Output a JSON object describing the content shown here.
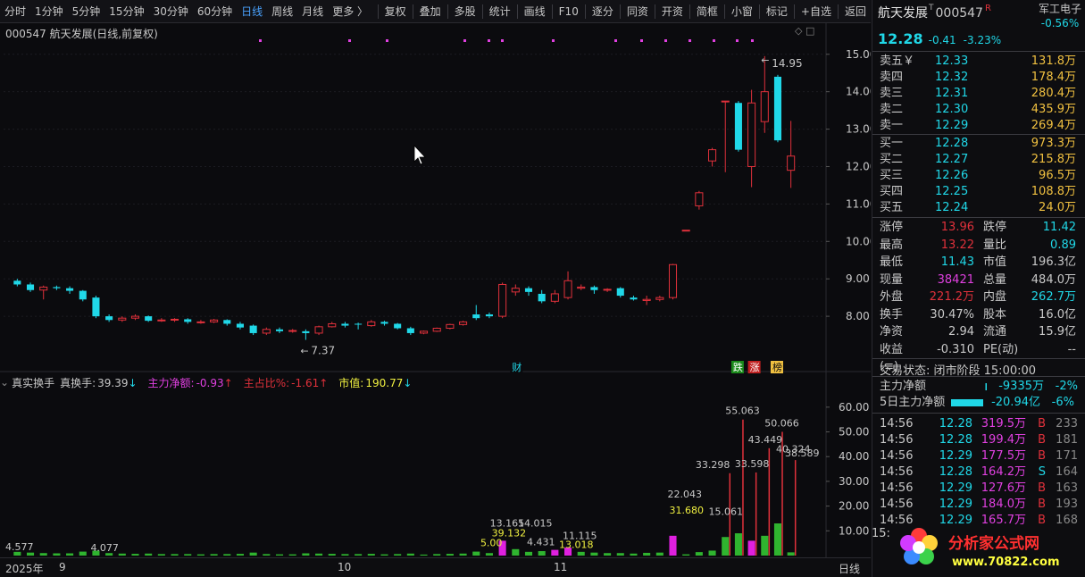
{
  "toolbar": {
    "items": [
      "分时",
      "1分钟",
      "5分钟",
      "15分钟",
      "30分钟",
      "60分钟",
      "日线",
      "周线",
      "月线",
      "更多 〉"
    ],
    "active": "日线",
    "tools": [
      "复权",
      "叠加",
      "多股",
      "统计",
      "画线",
      "F10",
      "逐分",
      "同资",
      "开资",
      "简框",
      "小窗",
      "标记",
      "+自选",
      "返回"
    ]
  },
  "chart": {
    "title": "000547 航天发展(日线,前复权)",
    "price_axis": [
      "15.00",
      "14.00",
      "13.00",
      "12.00",
      "11.00",
      "10.00",
      "9.00",
      "8.00"
    ],
    "high_label": "14.95",
    "low_label": "7.37",
    "markers": [
      "财",
      "跌",
      "涨",
      "榜"
    ],
    "indicator": {
      "name": "真实换手",
      "zhs_label": "真换手:",
      "zhs_value": "39.39",
      "zljq_label": "主力净额:",
      "zljq_value": "-0.93",
      "zzb_label": "主占比%:",
      "zzb_value": "-1.61",
      "sz_label": "市值:",
      "sz_value": "190.77"
    },
    "volume_axis": [
      "60.00",
      "50.00",
      "40.00",
      "30.00",
      "20.00",
      "10.00"
    ],
    "volume_labels": [
      "55.063",
      "50.066",
      "43.449",
      "40.324",
      "38.589",
      "33.298",
      "33.598",
      "22.043",
      "31.680",
      "15.061",
      "39.132",
      "13.165",
      "14.015",
      "11.115",
      "13.018",
      "5.00",
      "4.431",
      "4.577",
      "4.077"
    ],
    "dates": [
      "2025年",
      "9",
      "10",
      "11"
    ],
    "period": "日线"
  },
  "chart_data": {
    "type": "candlestick",
    "ylim": [
      7.0,
      15.4
    ],
    "candles": [
      [
        8.95,
        8.85,
        9.0,
        8.8
      ],
      [
        8.85,
        8.7,
        8.9,
        8.65
      ],
      [
        8.7,
        8.78,
        8.82,
        8.45
      ],
      [
        8.78,
        8.75,
        8.82,
        8.7
      ],
      [
        8.75,
        8.68,
        8.8,
        8.6
      ],
      [
        8.68,
        8.45,
        8.7,
        8.4
      ],
      [
        8.5,
        8.0,
        8.55,
        7.95
      ],
      [
        8.0,
        7.9,
        8.05,
        7.85
      ],
      [
        7.9,
        7.95,
        8.0,
        7.85
      ],
      [
        7.95,
        8.0,
        8.05,
        7.9
      ],
      [
        8.0,
        7.88,
        8.02,
        7.85
      ],
      [
        7.88,
        7.9,
        7.95,
        7.85
      ],
      [
        7.9,
        7.92,
        7.95,
        7.85
      ],
      [
        7.92,
        7.85,
        7.95,
        7.8
      ],
      [
        7.85,
        7.85,
        7.9,
        7.8
      ],
      [
        7.85,
        7.9,
        7.93,
        7.82
      ],
      [
        7.9,
        7.8,
        7.92,
        7.75
      ],
      [
        7.8,
        7.7,
        7.85,
        7.65
      ],
      [
        7.75,
        7.55,
        7.78,
        7.5
      ],
      [
        7.55,
        7.65,
        7.7,
        7.5
      ],
      [
        7.65,
        7.6,
        7.7,
        7.55
      ],
      [
        7.6,
        7.62,
        7.66,
        7.56
      ],
      [
        7.6,
        7.55,
        7.65,
        7.37
      ],
      [
        7.55,
        7.72,
        7.75,
        7.5
      ],
      [
        7.72,
        7.8,
        7.85,
        7.7
      ],
      [
        7.8,
        7.75,
        7.85,
        7.7
      ],
      [
        7.8,
        7.78,
        7.83,
        7.65
      ],
      [
        7.75,
        7.85,
        7.9,
        7.72
      ],
      [
        7.85,
        7.8,
        7.88,
        7.75
      ],
      [
        7.8,
        7.68,
        7.82,
        7.65
      ],
      [
        7.68,
        7.55,
        7.72,
        7.5
      ],
      [
        7.55,
        7.6,
        7.62,
        7.52
      ],
      [
        7.6,
        7.68,
        7.7,
        7.58
      ],
      [
        7.68,
        7.78,
        7.8,
        7.65
      ],
      [
        7.78,
        7.85,
        7.88,
        7.75
      ],
      [
        8.05,
        7.95,
        8.3,
        7.9
      ],
      [
        8.05,
        8.0,
        8.1,
        7.95
      ],
      [
        8.0,
        8.85,
        8.9,
        7.95
      ],
      [
        8.65,
        8.75,
        8.85,
        8.55
      ],
      [
        8.75,
        8.65,
        8.8,
        8.55
      ],
      [
        8.6,
        8.4,
        8.7,
        8.35
      ],
      [
        8.4,
        8.6,
        8.7,
        8.35
      ],
      [
        8.5,
        8.95,
        9.2,
        8.45
      ],
      [
        8.75,
        8.78,
        8.85,
        8.7
      ],
      [
        8.78,
        8.7,
        8.82,
        8.6
      ],
      [
        8.7,
        8.72,
        8.75,
        8.65
      ],
      [
        8.75,
        8.55,
        8.78,
        8.5
      ],
      [
        8.5,
        8.45,
        8.55,
        8.42
      ],
      [
        8.42,
        8.45,
        8.55,
        8.3
      ],
      [
        8.45,
        8.5,
        8.55,
        8.4
      ],
      [
        8.5,
        9.38,
        9.4,
        8.45
      ],
      [
        10.3,
        10.3,
        10.3,
        10.3
      ],
      [
        10.95,
        11.3,
        11.35,
        10.85
      ],
      [
        12.15,
        12.45,
        12.5,
        12.0
      ],
      [
        13.75,
        13.75,
        13.75,
        11.85
      ],
      [
        13.7,
        12.45,
        13.75,
        12.4
      ],
      [
        12.0,
        13.7,
        14.05,
        11.45
      ],
      [
        13.2,
        14.0,
        14.95,
        12.9
      ],
      [
        14.4,
        12.7,
        14.45,
        12.65
      ],
      [
        11.9,
        12.28,
        13.22,
        11.43
      ]
    ],
    "volumes": [
      [
        1.5,
        "up"
      ],
      [
        1.2,
        "down"
      ],
      [
        1.0,
        "up"
      ],
      [
        0.9,
        "down"
      ],
      [
        0.9,
        "down"
      ],
      [
        1.6,
        "down"
      ],
      [
        2.0,
        "down"
      ],
      [
        1.0,
        "down"
      ],
      [
        0.8,
        "up"
      ],
      [
        0.7,
        "up"
      ],
      [
        0.8,
        "down"
      ],
      [
        0.6,
        "up"
      ],
      [
        0.6,
        "up"
      ],
      [
        0.6,
        "down"
      ],
      [
        0.5,
        "up"
      ],
      [
        0.6,
        "up"
      ],
      [
        0.6,
        "down"
      ],
      [
        0.7,
        "down"
      ],
      [
        1.2,
        "down"
      ],
      [
        0.6,
        "up"
      ],
      [
        0.5,
        "down"
      ],
      [
        0.5,
        "up"
      ],
      [
        0.9,
        "down"
      ],
      [
        0.8,
        "up"
      ],
      [
        0.7,
        "up"
      ],
      [
        0.6,
        "down"
      ],
      [
        0.6,
        "down"
      ],
      [
        0.7,
        "up"
      ],
      [
        0.5,
        "down"
      ],
      [
        0.6,
        "down"
      ],
      [
        0.8,
        "down"
      ],
      [
        0.4,
        "up"
      ],
      [
        0.6,
        "up"
      ],
      [
        0.7,
        "up"
      ],
      [
        0.8,
        "up"
      ],
      [
        1.6,
        "down"
      ],
      [
        1.0,
        "down"
      ],
      [
        6.0,
        "pink"
      ],
      [
        2.6,
        "down"
      ],
      [
        1.5,
        "down"
      ],
      [
        1.8,
        "down"
      ],
      [
        2.3,
        "pink"
      ],
      [
        3.2,
        "pink"
      ],
      [
        1.5,
        "down"
      ],
      [
        1.2,
        "down"
      ],
      [
        1.0,
        "up"
      ],
      [
        1.0,
        "down"
      ],
      [
        0.8,
        "down"
      ],
      [
        1.1,
        "down"
      ],
      [
        1.2,
        "down"
      ],
      [
        8.0,
        "pink"
      ],
      [
        0.5,
        "up"
      ],
      [
        1.4,
        "up"
      ],
      [
        2.0,
        "up"
      ],
      [
        7.5,
        "down"
      ],
      [
        9.0,
        "down"
      ],
      [
        6.0,
        "pink"
      ],
      [
        8.0,
        "down"
      ],
      [
        13.0,
        "down"
      ],
      [
        1.3,
        "down"
      ]
    ]
  },
  "quote": {
    "name": "航天发展",
    "code": "000547",
    "r_mark": "R",
    "price": "12.28",
    "change": "-0.41",
    "change_pct": "-3.23%",
    "sector": "军工电子",
    "sector_pct": "-0.56%"
  },
  "orderbook": {
    "asks": [
      {
        "label": "卖五￥",
        "price": "12.33",
        "vol": "131.8万"
      },
      {
        "label": "卖四",
        "price": "12.32",
        "vol": "178.4万"
      },
      {
        "label": "卖三",
        "price": "12.31",
        "vol": "280.4万"
      },
      {
        "label": "卖二",
        "price": "12.30",
        "vol": "435.9万"
      },
      {
        "label": "卖一",
        "price": "12.29",
        "vol": "269.4万"
      }
    ],
    "bids": [
      {
        "label": "买一",
        "price": "12.28",
        "vol": "973.3万"
      },
      {
        "label": "买二",
        "price": "12.27",
        "vol": "215.8万"
      },
      {
        "label": "买三",
        "price": "12.26",
        "vol": "96.5万"
      },
      {
        "label": "买四",
        "price": "12.25",
        "vol": "108.8万"
      },
      {
        "label": "买五",
        "price": "12.24",
        "vol": "24.0万"
      }
    ]
  },
  "stats": [
    {
      "k1": "涨停",
      "v1": "13.96",
      "c1": "#e0313b",
      "k2": "跌停",
      "v2": "11.42",
      "c2": "#20d8e8"
    },
    {
      "k1": "最高",
      "v1": "13.22",
      "c1": "#e0313b",
      "k2": "量比",
      "v2": "0.89",
      "c2": "#20d8e8"
    },
    {
      "k1": "最低",
      "v1": "11.43",
      "c1": "#20d8e8",
      "k2": "市值",
      "v2": "196.3亿",
      "c2": "#c8c8c8"
    },
    {
      "k1": "现量",
      "v1": "38421",
      "c1": "#e040e0",
      "k2": "总量",
      "v2": "484.0万",
      "c2": "#c8c8c8"
    },
    {
      "k1": "外盘",
      "v1": "221.2万",
      "c1": "#e0313b",
      "k2": "内盘",
      "v2": "262.7万",
      "c2": "#20d8e8"
    },
    {
      "k1": "换手",
      "v1": "30.47%",
      "c1": "#c8c8c8",
      "k2": "股本",
      "v2": "16.0亿",
      "c2": "#c8c8c8"
    },
    {
      "k1": "净资",
      "v1": "2.94",
      "c1": "#c8c8c8",
      "k2": "流通",
      "v2": "15.9亿",
      "c2": "#c8c8c8"
    },
    {
      "k1": "收益(≡)",
      "v1": "-0.310",
      "c1": "#c8c8c8",
      "k2": "PE(动)",
      "v2": "--",
      "c2": "#c8c8c8"
    }
  ],
  "trade_state": "交易状态: 闭市阶段 15:00:00",
  "flow": [
    {
      "k": "主力净额",
      "amt": "-9335万",
      "pct": "-2%"
    },
    {
      "k": "5日主力净额",
      "amt": "-20.94亿",
      "pct": "-6%"
    }
  ],
  "ticks": [
    {
      "t": "14:56",
      "p": "12.28",
      "v": "319.5万",
      "s": "B",
      "n": "233"
    },
    {
      "t": "14:56",
      "p": "12.28",
      "v": "199.4万",
      "s": "B",
      "n": "181"
    },
    {
      "t": "14:56",
      "p": "12.29",
      "v": "177.5万",
      "s": "B",
      "n": "171"
    },
    {
      "t": "14:56",
      "p": "12.28",
      "v": "164.2万",
      "s": "S",
      "n": "164"
    },
    {
      "t": "14:56",
      "p": "12.29",
      "v": "127.6万",
      "s": "B",
      "n": "163"
    },
    {
      "t": "14:56",
      "p": "12.29",
      "v": "184.0万",
      "s": "B",
      "n": "193"
    },
    {
      "t": "14:56",
      "p": "12.29",
      "v": "165.7万",
      "s": "B",
      "n": "168"
    }
  ],
  "watermark": {
    "line1": "分析家公式网",
    "line2": "www.70822.com",
    "cut": "15:"
  },
  "colors": {
    "up": "#e0313b",
    "down": "#20d8e8",
    "accent": "#4aa3ff",
    "bg": "#0b0b0e"
  }
}
